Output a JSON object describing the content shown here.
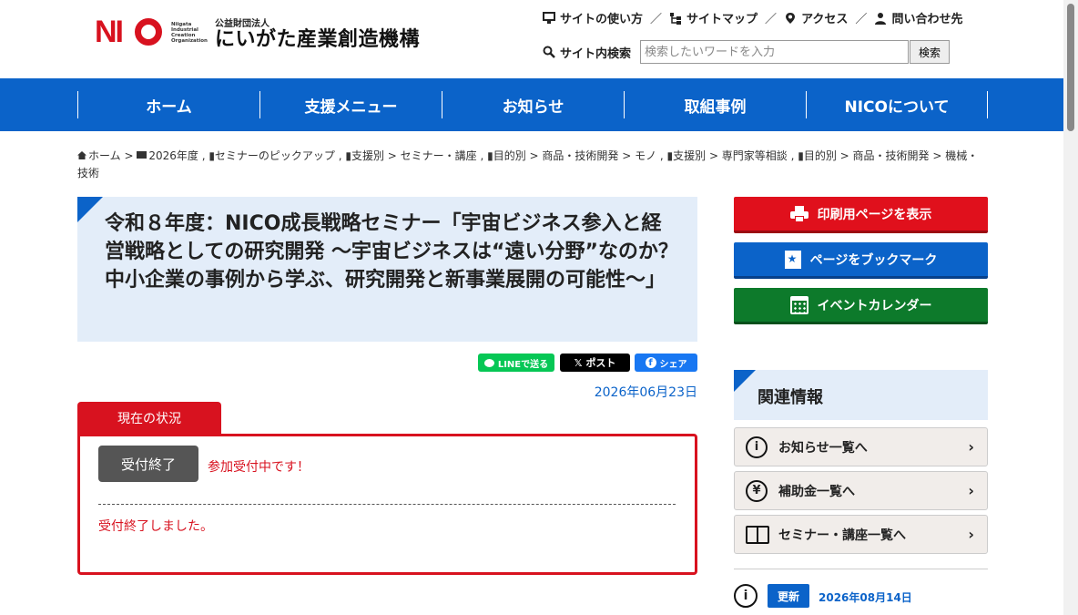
{
  "header": {
    "logo_mark": "NI",
    "logo_en": "Niigata Industrial Creation Organization",
    "logo_small": "公益財団法人",
    "logo_large": "にいがた産業創造機構",
    "util_links": [
      {
        "label": "サイトの使い方",
        "icon": "monitor-icon"
      },
      {
        "label": "サイトマップ",
        "icon": "sitemap-icon"
      },
      {
        "label": "アクセス",
        "icon": "map-pin-icon"
      },
      {
        "label": "問い合わせ先",
        "icon": "person-icon"
      }
    ],
    "util_sep": "／",
    "search_label": "サイト内検索",
    "search_placeholder": "検索したいワードを入力",
    "search_button": "検索"
  },
  "nav": {
    "items": [
      "ホーム",
      "支援メニュー",
      "お知らせ",
      "取組事例",
      "NICOについて"
    ]
  },
  "breadcrumb": {
    "home": "ホーム",
    "text": "2026年度 , ▮セミナーのピックアップ , ▮支援別 > セミナー・講座 , ▮目的別 > 商品・技術開発 > モノ , ▮支援別 > 専門家等相談 , ▮目的別 > 商品・技術開発 > 機械・技術"
  },
  "article": {
    "title": "令和８年度：NICO成長戦略セミナー「宇宙ビジネス参入と経営戦略としての研究開発 ～宇宙ビジネスは“遠い分野”なのか？　 中小企業の事例から学ぶ、研究開発と新事業展開の可能性～」",
    "share_line": "LINEで送る",
    "share_x": "ポスト",
    "share_fb": "シェア",
    "date": "2026年06月23日"
  },
  "status": {
    "tab": "現在の状況",
    "badge": "受付終了",
    "now": "参加受付中です！",
    "message": "受付終了しました。"
  },
  "sidebar": {
    "print": "印刷用ページを表示",
    "bookmark": "ページをブックマーク",
    "calendar": "イベントカレンダー",
    "related_title": "関連情報",
    "related": [
      {
        "label": "お知らせ一覧へ",
        "icon_char": "i"
      },
      {
        "label": "補助金一覧へ",
        "icon_char": "¥"
      },
      {
        "label": "セミナー・講座一覧へ",
        "icon_char": ""
      }
    ],
    "update_badge": "更新",
    "update_date": "2026年08月14日"
  },
  "colors": {
    "brand_blue": "#0b63c9",
    "brand_red": "#d8121f",
    "green": "#0d7a2b"
  }
}
